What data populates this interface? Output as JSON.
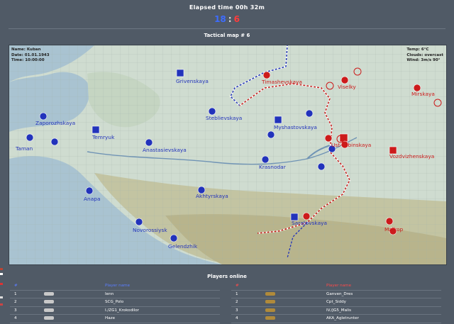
{
  "header": {
    "elapsed": "Elapsed time 00h 32m",
    "score_blue": "18",
    "score_sep": ":",
    "score_red": "6",
    "map_title": "Tactical map # 6"
  },
  "map_info": {
    "left": [
      "Name: Kuban",
      "Date: 01.01.1943",
      "Time: 10:00:00"
    ],
    "right": [
      "Temp: 6°C",
      "Clouds: overcast",
      "Wind: 3m/s 90°"
    ]
  },
  "towns": [
    {
      "name": "Grivenskaya",
      "side": "blue"
    },
    {
      "name": "Zaporozhskaya",
      "side": "blue"
    },
    {
      "name": "Temryuk",
      "side": "blue"
    },
    {
      "name": "Taman",
      "side": "blue"
    },
    {
      "name": "Anastasievskaya",
      "side": "blue"
    },
    {
      "name": "Anapa",
      "side": "blue"
    },
    {
      "name": "Novorossiysk",
      "side": "blue"
    },
    {
      "name": "Gelendzhik",
      "side": "blue"
    },
    {
      "name": "Akhtyrskaya",
      "side": "blue"
    },
    {
      "name": "Krasnodar",
      "side": "blue"
    },
    {
      "name": "Steblievskaya",
      "side": "blue"
    },
    {
      "name": "Myshastovskaya",
      "side": "blue"
    },
    {
      "name": "Saratovskaya",
      "side": "blue"
    },
    {
      "name": "Timashevskaya",
      "side": "red"
    },
    {
      "name": "Viselky",
      "side": "red"
    },
    {
      "name": "Mirskaya",
      "side": "red"
    },
    {
      "name": "Ust-Labinskaya",
      "side": "red"
    },
    {
      "name": "Vozdvizhenskaya",
      "side": "red"
    },
    {
      "name": "Maikop",
      "side": "red"
    }
  ],
  "players": {
    "title": "Players online",
    "blue": {
      "headers": [
        "#",
        "",
        "Player name"
      ],
      "rows": [
        {
          "num": "1",
          "name": "Ienn"
        },
        {
          "num": "2",
          "name": "SCG_Polo"
        },
        {
          "num": "3",
          "name": "I./ZG1_Krokodilor"
        },
        {
          "num": "4",
          "name": "Haze"
        }
      ]
    },
    "red": {
      "headers": [
        "#",
        "",
        "Player name"
      ],
      "rows": [
        {
          "num": "1",
          "name": "Ganven_Dres"
        },
        {
          "num": "2",
          "name": "Cpt_Siddy"
        },
        {
          "num": "3",
          "name": "IV./JG5_Malis"
        },
        {
          "num": "4",
          "name": "AKA_Agletrunter"
        }
      ]
    }
  },
  "colors": {
    "blue": "#2233bb",
    "red": "#cc1b1b",
    "land": "#cfdcd0",
    "sea": "#a9c3d1"
  }
}
